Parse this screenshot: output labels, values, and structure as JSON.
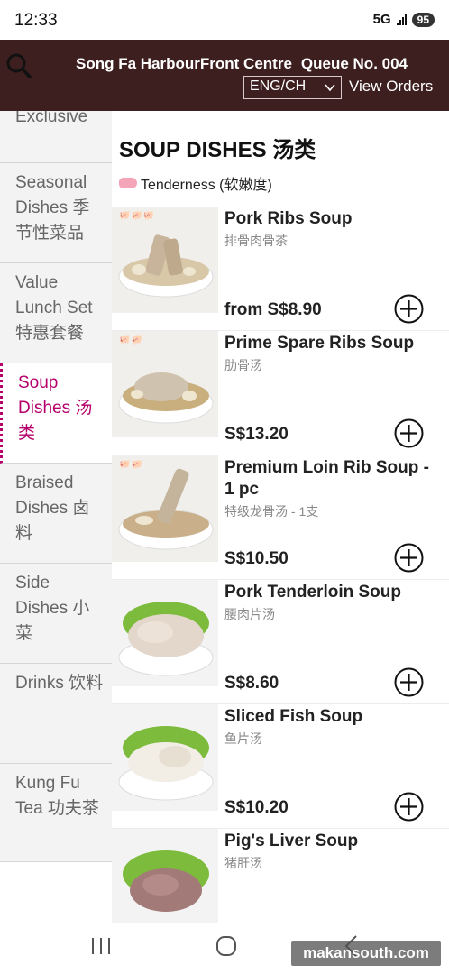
{
  "status_bar": {
    "time": "12:33",
    "network": "5G",
    "battery": "95"
  },
  "header": {
    "store_name": "Song Fa HarbourFront Centre",
    "queue": "Queue No. 004",
    "language": "ENG/CH",
    "view_orders": "View Orders",
    "color": "#3e1f1f"
  },
  "sidebar": {
    "items": [
      {
        "label": "Exclusive"
      },
      {
        "label": "Seasonal Dishes 季节性菜品"
      },
      {
        "label": "Value Lunch Set 特惠套餐"
      },
      {
        "label": "Soup Dishes 汤类",
        "active": true
      },
      {
        "label": "Braised Dishes 卤料"
      },
      {
        "label": "Side Dishes 小菜"
      },
      {
        "label": "Drinks 饮料"
      },
      {
        "label": "Kung Fu Tea 功夫茶"
      }
    ],
    "active_color": "#b5006b"
  },
  "main": {
    "section_title": "SOUP DISHES 汤类",
    "tenderness_label": "Tenderness (软嫩度)",
    "items": [
      {
        "name": "Pork Ribs Soup",
        "sub": "排骨肉骨茶",
        "price": "from S$8.90",
        "tenderness": 3
      },
      {
        "name": "Prime Spare Ribs Soup",
        "sub": "肋骨汤",
        "price": "S$13.20",
        "tenderness": 2
      },
      {
        "name": "Premium Loin Rib Soup - 1 pc",
        "sub": "特级龙骨汤 - 1支",
        "price": "S$10.50",
        "tenderness": 2
      },
      {
        "name": "Pork Tenderloin Soup",
        "sub": "腰肉片汤",
        "price": "S$8.60",
        "tenderness": 0
      },
      {
        "name": "Sliced Fish Soup",
        "sub": "鱼片汤",
        "price": "S$10.20",
        "tenderness": 0
      },
      {
        "name": "Pig's Liver Soup",
        "sub": "猪肝汤",
        "price": "",
        "tenderness": 0
      }
    ]
  },
  "watermark": "makansouth.com"
}
